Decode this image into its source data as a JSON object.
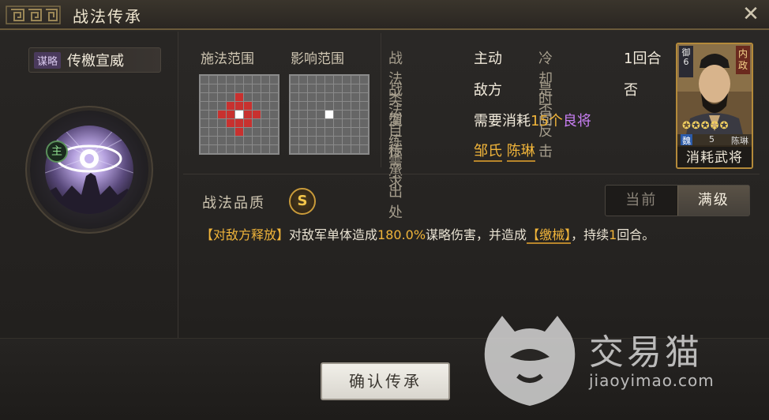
{
  "window": {
    "title": "战法传承"
  },
  "skill": {
    "type_tag": "谋略",
    "name": "传檄宣威",
    "main_badge": "主"
  },
  "ranges": {
    "cast_label": "施法范围",
    "effect_label": "影响范围"
  },
  "info": {
    "type_key": "战法类型",
    "type_val": "主动",
    "cooldown_key": "冷却时间",
    "cooldown_val": "1回合",
    "target_key": "战法目标",
    "target_val": "敌方",
    "counter_key": "是否反击",
    "counter_val": "否",
    "train_key": "演练需求",
    "train_prefix": "需要消耗",
    "train_count": "15个",
    "train_item": "良将",
    "origin_key": "传承出处",
    "origin_1": "邹氏",
    "origin_2": "陈琳"
  },
  "card": {
    "camp": "御 6",
    "role": "内政",
    "stars": "✪✪✪✪✪",
    "faction": "魏",
    "level": "5",
    "name": "陈琳",
    "caption": "消耗武将"
  },
  "quality": {
    "label": "战法品质",
    "grade": "S"
  },
  "toggle": {
    "current": "当前",
    "max": "满级"
  },
  "description": {
    "bracket_1": "【对敌方释放】",
    "text_1": "对敌军单体造成",
    "percent": "180.0%",
    "text_2": "谋略伤害，并造成",
    "bracket_2": "【缴械】",
    "text_3": "，持续",
    "duration": "1",
    "text_4": "回合。"
  },
  "actions": {
    "confirm": "确认传承"
  },
  "watermark": {
    "cn": "交易猫",
    "en": "jiaoyimao.com"
  },
  "colors": {
    "accent_gold": "#f0b43a",
    "purple": "#c77ef2",
    "cell_red": "#c8312f"
  }
}
